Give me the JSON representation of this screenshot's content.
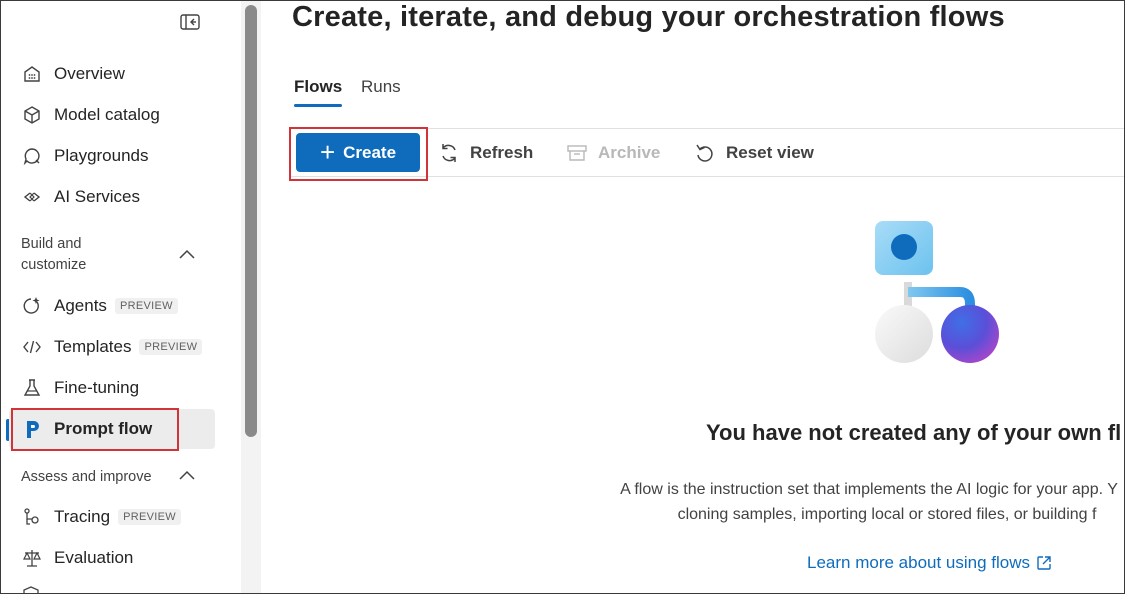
{
  "sidebar": {
    "items": [
      {
        "label": "Overview"
      },
      {
        "label": "Model catalog"
      },
      {
        "label": "Playgrounds"
      },
      {
        "label": "AI Services"
      },
      {
        "label": "Agents",
        "badge": "PREVIEW"
      },
      {
        "label": "Templates",
        "badge": "PREVIEW"
      },
      {
        "label": "Fine-tuning"
      },
      {
        "label": "Prompt flow"
      },
      {
        "label": "Tracing",
        "badge": "PREVIEW"
      },
      {
        "label": "Evaluation"
      }
    ],
    "sections": {
      "build_line1": "Build and",
      "build_line2": "customize",
      "assess": "Assess and improve"
    }
  },
  "main": {
    "title": "Create, iterate, and debug your orchestration flows",
    "tabs": [
      {
        "label": "Flows"
      },
      {
        "label": "Runs"
      }
    ],
    "toolbar": {
      "create": "Create",
      "refresh": "Refresh",
      "archive": "Archive",
      "reset": "Reset view"
    },
    "empty": {
      "title": "You have not created any of your own fl",
      "desc_line1": "A flow is the instruction set that implements the AI logic for your app. Y",
      "desc_line2": "cloning samples, importing local or stored files, or building f",
      "link": "Learn more about using flows"
    }
  },
  "colors": {
    "accent": "#0f6cbd",
    "highlight": "#d13438"
  }
}
